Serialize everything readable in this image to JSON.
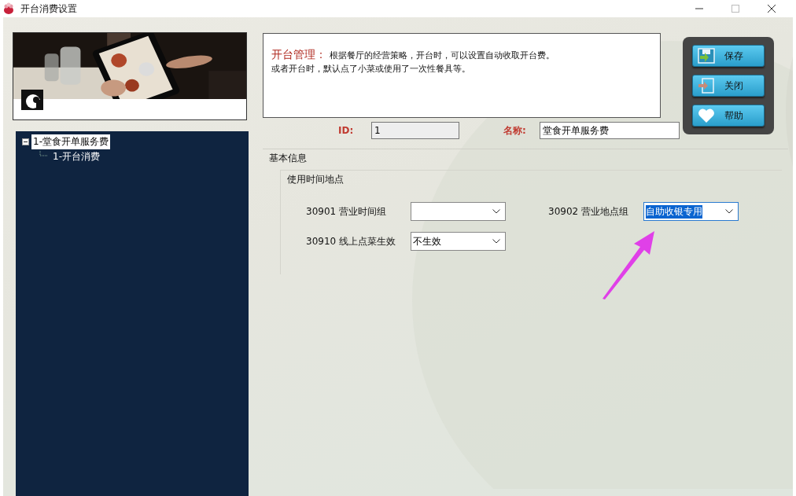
{
  "window": {
    "title": "开台消费设置"
  },
  "tree": [
    {
      "label": "1-堂食开单服务费",
      "selected": true,
      "expanded": true,
      "children": [
        {
          "label": "1-开台消费",
          "selected": false
        }
      ]
    }
  ],
  "description": {
    "title": "开台管理：",
    "lines": [
      "根据餐厅的经营策略，开台时，可以设置自动收取开台费。",
      "或者开台时，默认点了小菜或使用了一次性餐具等。"
    ]
  },
  "buttons": [
    {
      "label": "保存",
      "kind": "save"
    },
    {
      "label": "关闭",
      "kind": "exit"
    },
    {
      "label": "帮助",
      "kind": "help"
    }
  ],
  "id_field": {
    "label": "ID:",
    "value": "1",
    "disabled": true
  },
  "name_field": {
    "label": "名称:",
    "value": "堂食开单服务费",
    "disabled": false
  },
  "group": {
    "title": "基本信息",
    "subgroup": {
      "title": "使用时间地点",
      "selects": [
        {
          "label": "30901 营业时间组",
          "focused": false
        },
        {
          "label": "30902 营业地点组",
          "value": "自助收银专用",
          "focused": true
        },
        {
          "label": "30910 线上点菜生效",
          "value": "不生效",
          "focused": false
        }
      ]
    }
  },
  "annotation": {
    "kind": "arrow"
  }
}
